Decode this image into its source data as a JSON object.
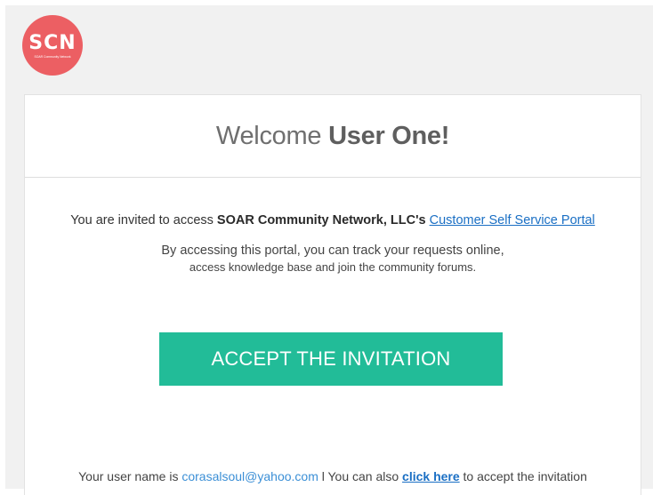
{
  "logo": {
    "text": "SCN",
    "subtext": "SOAR Community Network",
    "color": "#ec5f63"
  },
  "welcome": {
    "prefix": "Welcome",
    "name": "User One!"
  },
  "invite": {
    "prefix": "You are invited to access ",
    "company": "SOAR Community Network, LLC's",
    "link": "Customer Self Service Portal"
  },
  "description": {
    "line1": "By accessing this portal, you can track your requests online,",
    "line2": "access knowledge base and join the community forums."
  },
  "accept_button": {
    "label": "ACCEPT THE INVITATION",
    "color": "#22bc98"
  },
  "footer": {
    "username_prefix": "Your user name is ",
    "email": "corasalsoul@yahoo.com",
    "separator": " l You can also ",
    "click_link": "click here",
    "suffix": " to accept the invitation"
  }
}
